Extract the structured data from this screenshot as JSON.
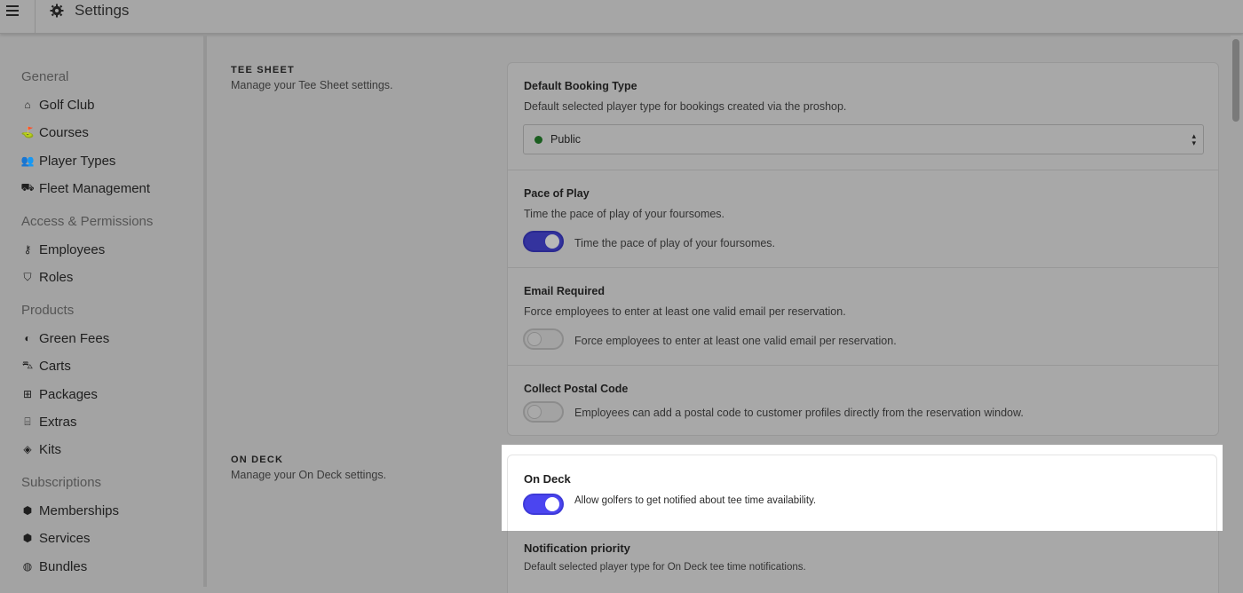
{
  "header": {
    "title": "Settings",
    "menu_icon": "hamburger-icon",
    "title_icon": "gear-icon"
  },
  "sidebar": {
    "sections": [
      {
        "label": "General",
        "items": [
          {
            "label": "Golf Club",
            "icon": "clubhouse-icon"
          },
          {
            "label": "Courses",
            "icon": "golfer-icon"
          },
          {
            "label": "Player Types",
            "icon": "users-icon"
          },
          {
            "label": "Fleet Management",
            "icon": "cart-icon"
          }
        ]
      },
      {
        "label": "Access & Permissions",
        "items": [
          {
            "label": "Employees",
            "icon": "key-icon"
          },
          {
            "label": "Roles",
            "icon": "shield-icon"
          }
        ]
      },
      {
        "label": "Products",
        "items": [
          {
            "label": "Green Fees",
            "icon": "globe-icon"
          },
          {
            "label": "Carts",
            "icon": "golf-cart-icon"
          },
          {
            "label": "Packages",
            "icon": "gift-icon"
          },
          {
            "label": "Extras",
            "icon": "store-icon"
          },
          {
            "label": "Kits",
            "icon": "box-icon"
          }
        ]
      },
      {
        "label": "Subscriptions",
        "items": [
          {
            "label": "Memberships",
            "icon": "badge-icon"
          },
          {
            "label": "Services",
            "icon": "badge-icon"
          },
          {
            "label": "Bundles",
            "icon": "layers-icon"
          }
        ]
      }
    ]
  },
  "tee_sheet": {
    "title": "TEE SHEET",
    "description": "Manage your Tee Sheet settings.",
    "default_booking": {
      "label": "Default Booking Type",
      "help": "Default selected player type for bookings created via the proshop.",
      "value": "Public",
      "dot_color": "#1b5e20"
    },
    "pace_of_play": {
      "label": "Pace of Play",
      "help": "Time the pace of play of your foursomes.",
      "toggle_text": "Time the pace of play of your foursomes.",
      "enabled": true
    },
    "email_required": {
      "label": "Email Required",
      "help": "Force employees to enter at least one valid email per reservation.",
      "toggle_text": "Force employees to enter at least one valid email per reservation.",
      "enabled": false
    },
    "postal_code": {
      "label": "Collect Postal Code",
      "toggle_text": "Employees can add a postal code to customer profiles directly from the reservation window.",
      "enabled": false
    }
  },
  "on_deck": {
    "title": "ON DECK",
    "description": "Manage your On Deck settings.",
    "toggle_label": "On Deck",
    "toggle_text": "Allow golfers to get notified about tee time availability.",
    "enabled": true,
    "accent": "#4b45f0",
    "priority": {
      "label": "Notification priority",
      "help": "Default selected player type for On Deck tee time notifications."
    }
  }
}
